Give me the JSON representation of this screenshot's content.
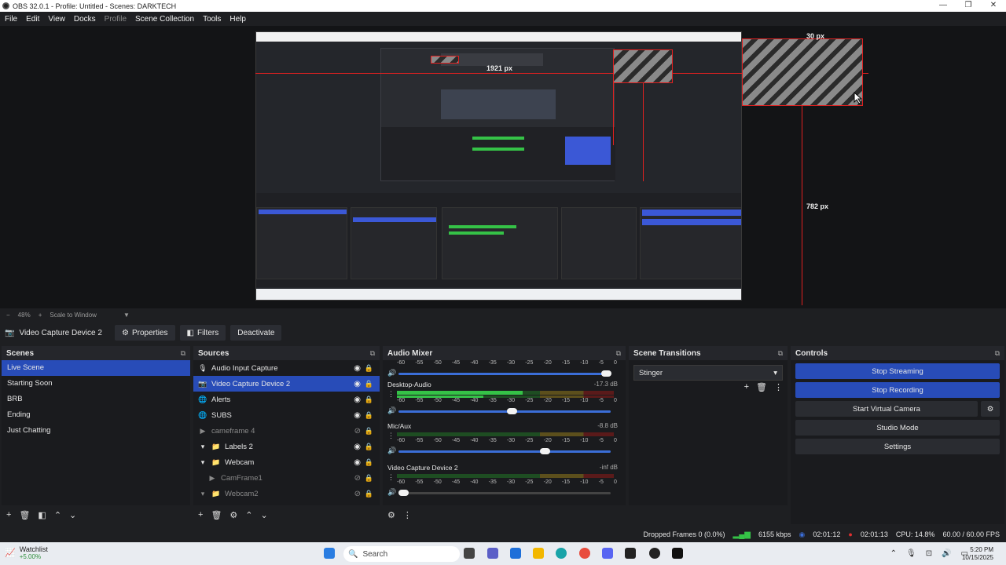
{
  "window": {
    "title": "OBS 32.0.1 - Profile: Untitled - Scenes: DARKTECH",
    "minimize": "—",
    "restore": "❐",
    "close": "✕"
  },
  "menu": [
    "File",
    "Edit",
    "View",
    "Docks",
    "Profile",
    "Scene Collection",
    "Tools",
    "Help"
  ],
  "preview": {
    "label_width": "1921 px",
    "label_top": "30 px",
    "label_height": "782 px"
  },
  "zoom": {
    "minus": "−",
    "value": "48%",
    "plus": "+",
    "mode": "Scale to Window"
  },
  "source_toolbar": {
    "selected_source": "Video Capture Device 2",
    "properties": "Properties",
    "filters": "Filters",
    "deactivate": "Deactivate"
  },
  "scenes": {
    "title": "Scenes",
    "items": [
      "Live Scene",
      "Starting Soon",
      "BRB",
      "Ending",
      "Just Chatting"
    ],
    "selected": 0
  },
  "sources": {
    "title": "Sources",
    "items": [
      {
        "label": "Audio Input Capture",
        "icon": "🎙"
      },
      {
        "label": "Video Capture Device 2",
        "icon": "📷"
      },
      {
        "label": "Alerts",
        "icon": "🌐"
      },
      {
        "label": "SUBS",
        "icon": "🌐"
      },
      {
        "label": "cameframe 4",
        "icon": "▶"
      },
      {
        "label": "Labels 2",
        "icon": "📁"
      },
      {
        "label": "Webcam",
        "icon": "📁"
      },
      {
        "label": "CamFrame1",
        "icon": "▶"
      },
      {
        "label": "Webcam2",
        "icon": "📁"
      }
    ]
  },
  "mixer": {
    "title": "Audio Mixer",
    "ticks": [
      "-60",
      "-55",
      "-50",
      "-45",
      "-40",
      "-35",
      "-30",
      "-25",
      "-20",
      "-15",
      "-10",
      "-5",
      "0"
    ],
    "channels": [
      {
        "name": "",
        "db": ""
      },
      {
        "name": "Desktop-Audio",
        "db": "-17.3 dB"
      },
      {
        "name": "Mic/Aux",
        "db": "-8.8 dB"
      },
      {
        "name": "Video Capture Device 2",
        "db": "-inf dB"
      }
    ]
  },
  "transitions": {
    "title": "Scene Transitions",
    "selected": "Stinger"
  },
  "controls": {
    "title": "Controls",
    "buttons": [
      "Stop Streaming",
      "Stop Recording",
      "Start Virtual Camera",
      "Studio Mode",
      "Settings"
    ]
  },
  "status": {
    "dropped": "Dropped Frames 0 (0.0%)",
    "bitrate": "6155 kbps",
    "stream_time": "02:01:12",
    "rec_time": "02:01:13",
    "cpu": "CPU: 14.8%",
    "fps": "60.00 / 60.00 FPS"
  },
  "taskbar": {
    "watch_title": "Watchlist",
    "watch_sub": "+5.00%",
    "search": "Search",
    "time": "5:20 PM",
    "date": "10/15/2025"
  }
}
